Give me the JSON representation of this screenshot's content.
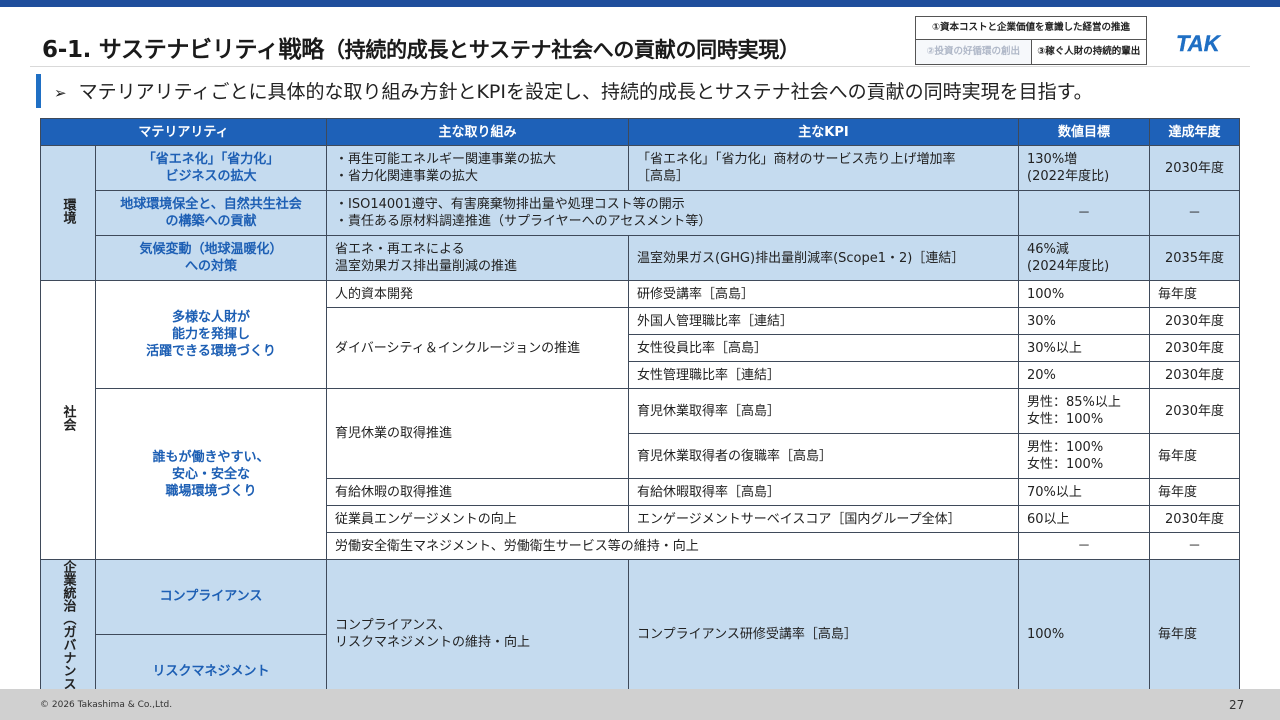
{
  "header": {
    "title_main": "6-1. サステナビリティ戦略",
    "title_sub": "（持続的成長とサステナ社会への貢献の同時実現）",
    "policy_1": "①資本コストと企業価値を意識した経営の推進",
    "policy_2": "②投資の好循環の創出",
    "policy_3": "③稼ぐ人財の持続的輩出",
    "logo_text": "TAK",
    "brand_color": "#1f6fc4"
  },
  "lead": {
    "arrow": "➢",
    "text": "マテリアリティごとに具体的な取り組み方針とKPIを設定し、持続的成長とサステナ社会への貢献の同時実現を目指す。"
  },
  "table": {
    "headers": [
      "マテリアリティ",
      "主な取り組み",
      "主なKPI",
      "数値目標",
      "達成年度"
    ],
    "categories": {
      "env": "環境",
      "soc": "社会",
      "gov": "企業統治（ガバナンス）"
    },
    "env": {
      "r1": {
        "mat": "「省エネ化」「省力化」\nビジネスの拡大",
        "act": "・再生可能エネルギー関連事業の拡大\n・省力化関連事業の拡大",
        "kpi": "「省エネ化」「省力化」商材のサービス売り上げ増加率\n［高島］",
        "target": "130%増\n(2022年度比)",
        "year": "2030年度"
      },
      "r2": {
        "mat": "地球環境保全と、自然共生社会\nの構築への貢献",
        "act": "・ISO14001遵守、有害廃棄物排出量や処理コスト等の開示\n・責任ある原材料調達推進（サプライヤーへのアセスメント等）",
        "target": "－",
        "year": "－"
      },
      "r3": {
        "mat": "気候変動（地球温暖化）\nへの対策",
        "act": "省エネ・再エネによる\n温室効果ガス排出量削減の推進",
        "kpi": "温室効果ガス(GHG)排出量削減率(Scope1・2)［連結］",
        "target": "46%減\n(2024年度比)",
        "year": "2035年度"
      }
    },
    "soc": {
      "mat1": "多様な人財が\n能力を発揮し\n活躍できる環境づくり",
      "mat2": "誰もが働きやすい、\n安心・安全な\n職場環境づくり",
      "r1": {
        "act": "人的資本開発",
        "kpi": "研修受講率［高島］",
        "target": "100%",
        "year": "毎年度"
      },
      "act_div": "ダイバーシティ＆インクルージョンの推進",
      "r2": {
        "kpi": "外国人管理職比率［連結］",
        "target": "30%",
        "year": "2030年度"
      },
      "r3": {
        "kpi": "女性役員比率［高島］",
        "target": "30%以上",
        "year": "2030年度"
      },
      "r4": {
        "kpi": "女性管理職比率［連結］",
        "target": "20%",
        "year": "2030年度"
      },
      "act_child": "育児休業の取得推進",
      "r5": {
        "kpi": "育児休業取得率［高島］",
        "target": "男性：85%以上\n女性：100%",
        "year": "2030年度"
      },
      "r6": {
        "kpi": "育児休業取得者の復職率［高島］",
        "target": "男性：100%\n女性：100%",
        "year": "毎年度"
      },
      "r7": {
        "act": "有給休暇の取得推進",
        "kpi": "有給休暇取得率［高島］",
        "target": "70%以上",
        "year": "毎年度"
      },
      "r8": {
        "act": "従業員エンゲージメントの向上",
        "kpi": "エンゲージメントサーベイスコア［国内グループ全体］",
        "target": "60以上",
        "year": "2030年度"
      },
      "r9": {
        "act": "労働安全衛生マネジメント、労働衛生サービス等の維持・向上",
        "target": "－",
        "year": "－"
      }
    },
    "gov": {
      "mat1": "コンプライアンス",
      "mat2": "リスクマネジメント",
      "act": "コンプライアンス、\nリスクマネジメントの維持・向上",
      "kpi": "コンプライアンス研修受講率［高島］",
      "target": "100%",
      "year": "毎年度"
    }
  },
  "footer": {
    "copyright": "© 2026  Takashima & Co.,Ltd.",
    "page": "27"
  }
}
